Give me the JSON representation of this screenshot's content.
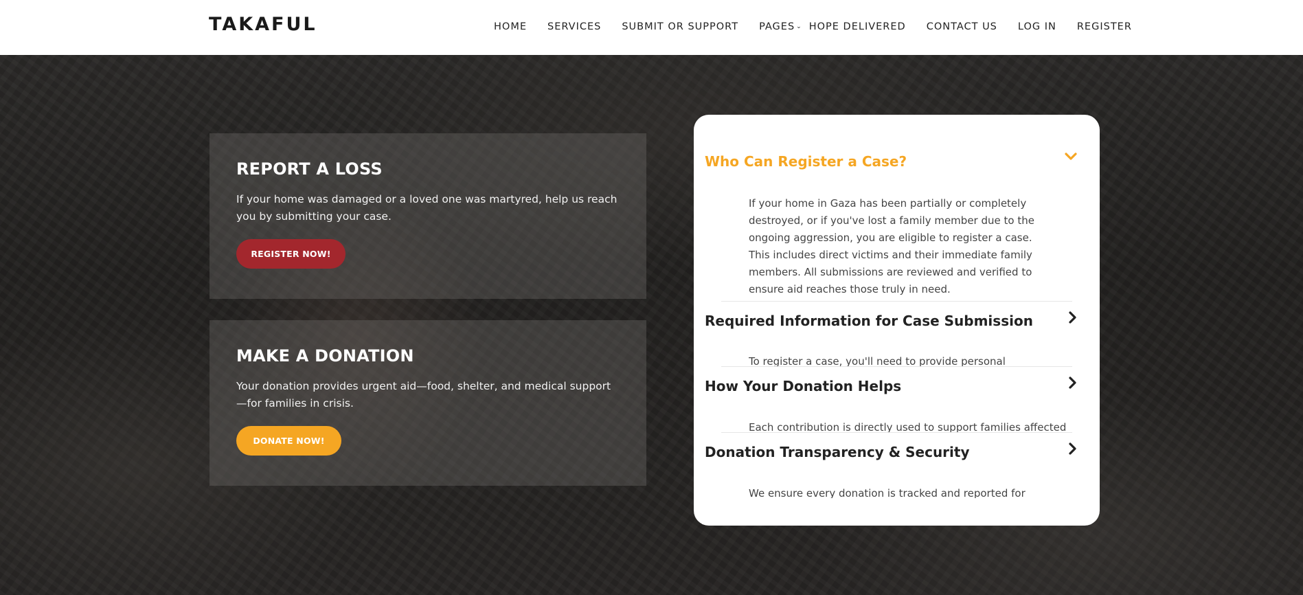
{
  "header": {
    "logo": "TAKAFUL",
    "nav": [
      {
        "label": "HOME"
      },
      {
        "label": "SERVICES"
      },
      {
        "label": "SUBMIT OR SUPPORT"
      },
      {
        "label": "PAGES"
      },
      {
        "label": "HOPE DELIVERED"
      },
      {
        "label": "CONTACT US"
      },
      {
        "label": "LOG IN"
      },
      {
        "label": "REGISTER"
      }
    ]
  },
  "cards": {
    "loss": {
      "title": "REPORT A LOSS",
      "text": "If your home was damaged or a loved one was martyred, help us reach you by submitting your case.",
      "button": "REGISTER NOW!"
    },
    "donation": {
      "title": "MAKE A DONATION",
      "text": "Your donation provides urgent aid—food, shelter, and medical support—for families in crisis.",
      "button": "DONATE NOW!"
    }
  },
  "faq": [
    {
      "question": "Who Can Register a Case?",
      "answer": "If your home in Gaza has been partially or completely destroyed, or if you've lost a family member due to the ongoing aggression, you are eligible to register a case. This includes direct victims and their immediate family members. All submissions are reviewed and verified to ensure aid reaches those truly in need.",
      "expanded": true
    },
    {
      "question": "Required Information for Case Submission",
      "answer": "To register a case, you'll need to provide personal",
      "expanded": false
    },
    {
      "question": "How Your Donation Helps",
      "answer": "Each contribution is directly used to support families affected",
      "expanded": false
    },
    {
      "question": "Donation Transparency & Security",
      "answer": "We ensure every donation is tracked and reported for",
      "expanded": false
    }
  ],
  "colors": {
    "accent_orange": "#f5a623",
    "register_red": "#a3272d"
  }
}
